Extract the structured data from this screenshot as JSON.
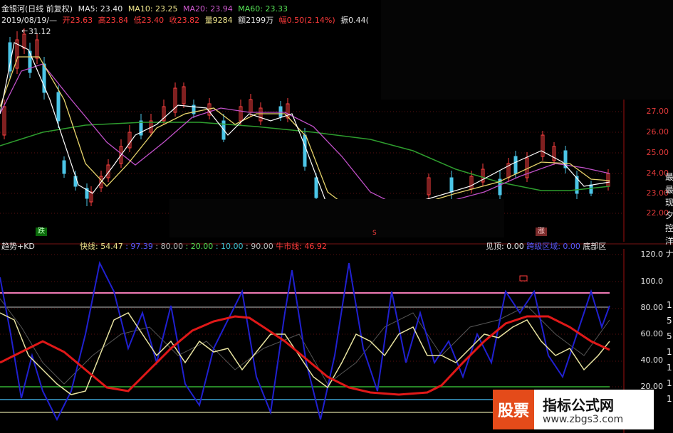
{
  "header": {
    "stock_name": "金银河(日线 前复权)",
    "ma5": "MA5: 23.40",
    "ma10": "MA10: 23.25",
    "ma20": "MA20: 23.94",
    "ma60": "MA60: 23.33",
    "date": "2019/08/19/—",
    "open": "开23.63",
    "high": "高23.84",
    "low": "低23.40",
    "close": "收23.82",
    "volume": "量9284",
    "amount": "额2199万",
    "change": "幅0.50(2.14%)",
    "amplitude": "振0.44("
  },
  "price_panel": {
    "peak_label": "31.12",
    "right_axis": [
      "27.00",
      "26.00",
      "25.00",
      "24.00",
      "23.00",
      "22.00"
    ],
    "right_edge_chars": [
      "最",
      "最",
      "现",
      "夕",
      "控",
      "洋",
      "ナ"
    ],
    "tags": {
      "drop": "跌",
      "rise": "涨",
      "s": "S"
    },
    "colors": {
      "ma5": "#ffffff",
      "ma10": "#e6d36b",
      "ma20": "#c050c8",
      "ma60": "#2e9d2e"
    }
  },
  "indicator_panel": {
    "name": "趋势+KD",
    "fast_line": "快线: 54.47",
    "k_value": ": 97.39",
    "v80": ": 80.00",
    "v20": ": 20.00",
    "v10": ": 10.00",
    "v90": ": 90.00",
    "bull_line": "牛市线: 46.92",
    "top": "见顶: 0.00",
    "bottom_zone": "跨级区域: 0.00",
    "bottom_label": "底部区",
    "right_axis": [
      "120.0",
      "100.0",
      "80.00",
      "60.00",
      "40.00",
      "20.00"
    ],
    "right_edge_chars": [
      "1",
      "5",
      "5",
      "1",
      "1",
      "1",
      "1"
    ]
  },
  "ad": {
    "logo": "股票",
    "title": "指标公式网",
    "url": "www.zbgs3.com"
  }
}
